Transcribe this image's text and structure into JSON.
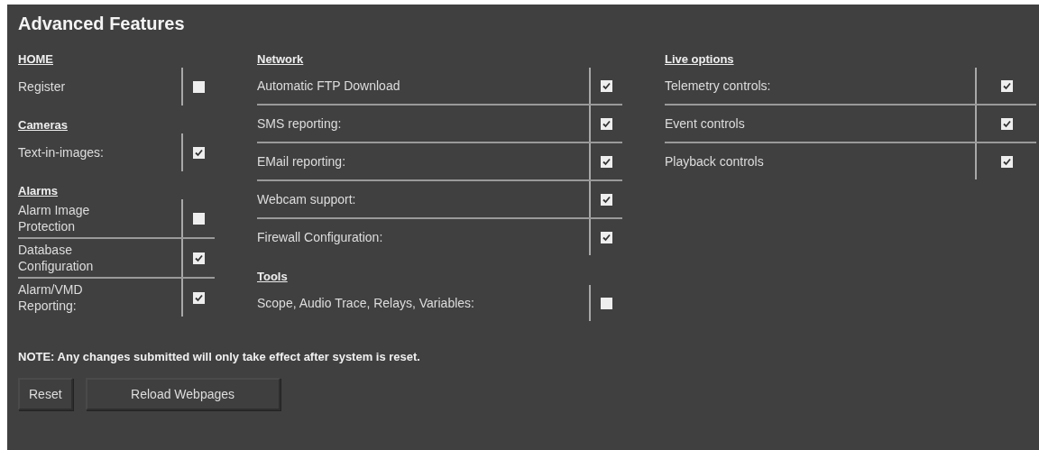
{
  "title": "Advanced Features",
  "columns": [
    {
      "sections": [
        {
          "heading": "HOME",
          "options": [
            {
              "label": "Register",
              "checked": false
            }
          ]
        },
        {
          "heading": "Cameras",
          "options": [
            {
              "label": "Text-in-images:",
              "checked": true
            }
          ]
        },
        {
          "heading": "Alarms",
          "options": [
            {
              "label": "Alarm Image Protection",
              "checked": false
            },
            {
              "label": "Database Configuration",
              "checked": true
            },
            {
              "label": "Alarm/VMD Reporting:",
              "checked": true
            }
          ]
        }
      ]
    },
    {
      "sections": [
        {
          "heading": "Network",
          "options": [
            {
              "label": "Automatic FTP Download",
              "checked": true
            },
            {
              "label": "SMS reporting:",
              "checked": true
            },
            {
              "label": "EMail reporting:",
              "checked": true
            },
            {
              "label": "Webcam support:",
              "checked": true
            },
            {
              "label": "Firewall Configuration:",
              "checked": true
            }
          ]
        },
        {
          "heading": "Tools",
          "options": [
            {
              "label": "Scope, Audio Trace, Relays, Variables:",
              "checked": false
            }
          ]
        }
      ]
    },
    {
      "sections": [
        {
          "heading": "Live options",
          "options": [
            {
              "label": "Telemetry controls:",
              "checked": true
            },
            {
              "label": "Event controls",
              "checked": true
            },
            {
              "label": "Playback controls",
              "checked": true
            }
          ]
        }
      ]
    }
  ],
  "note": "NOTE: Any changes submitted will only take effect after system is reset.",
  "buttons": [
    "Reset",
    "Reload Webpages"
  ]
}
